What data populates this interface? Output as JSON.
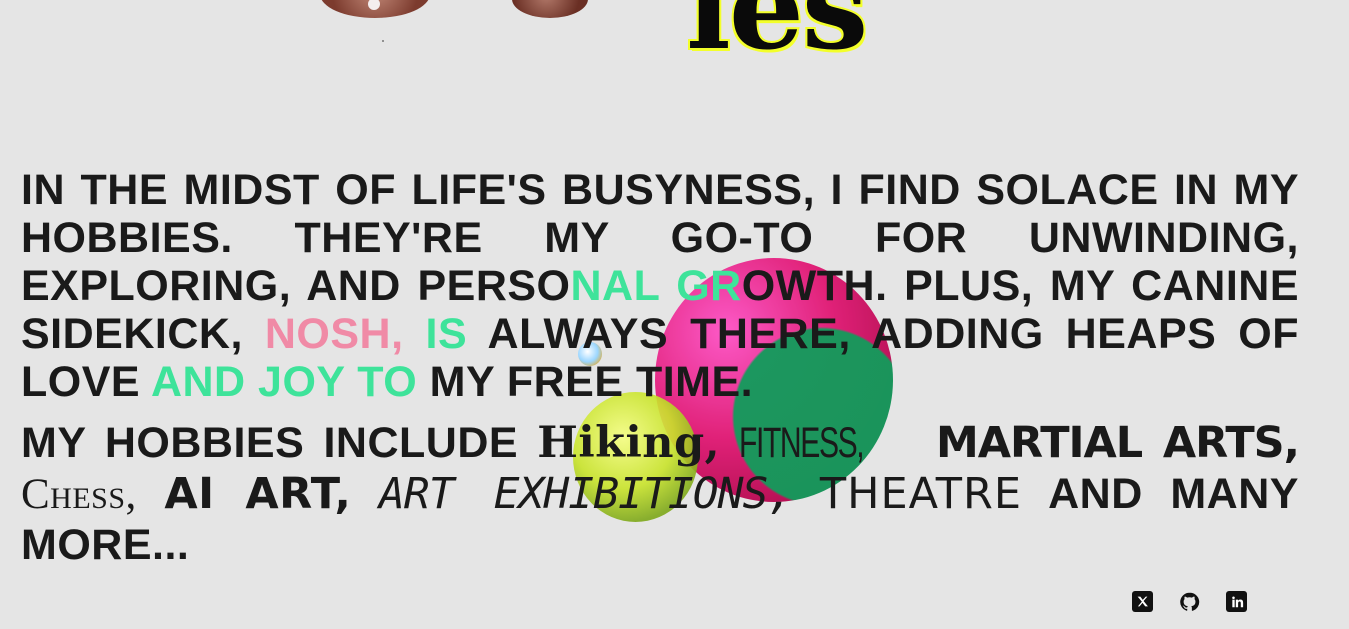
{
  "top": {
    "heading_fragment": "ies"
  },
  "intro": {
    "line_a": "In the midst of life's busyness, I find solace in my hobbies. They're my go-to for unwinding, exploring, and perso",
    "line_b_nal": "nal",
    "line_c": " ",
    "line_d_gr": "gr",
    "line_e": "owth. Plus, my canine sidekick, ",
    "nosh": "Nosh,",
    "line_f": " ",
    "is": "is",
    "line_g": " always there, adding heaps of love ",
    "and_joy": "and joy",
    "line_h": " ",
    "to": "to",
    "line_i": " my free time."
  },
  "hobbies": {
    "prefix": "My hobbies include",
    "hiking": "Hiking,",
    "fitness": "Fitness,",
    "martial_arts": "Martial Arts,",
    "chess": "Chess,",
    "ai_art": "AI Art,",
    "art_exhibitions": "Art Exhibitions,",
    "theatre": "Theatre",
    "suffix": "and many more..."
  },
  "social": {
    "x_icon": "x-twitter-icon",
    "github_icon": "github-icon",
    "linkedin_icon": "linkedin-icon"
  },
  "colors": {
    "background": "#e5e5e5",
    "text": "#1a1a1a",
    "heading_outline": "#f3ff2a",
    "sphere_pink": "#e0116f",
    "sphere_green": "#009650",
    "sphere_yellow": "#c9e42a"
  }
}
